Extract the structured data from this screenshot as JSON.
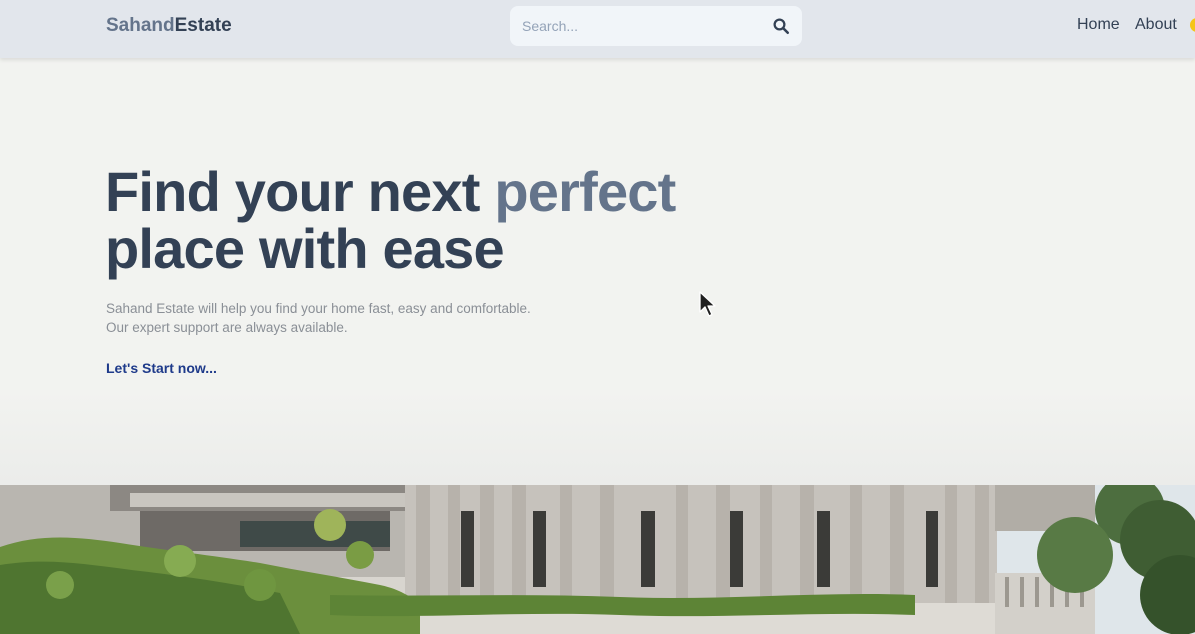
{
  "header": {
    "logo_part1": "Sahand",
    "logo_part2": "Estate",
    "search_placeholder": "Search...",
    "nav": [
      "Home",
      "About"
    ]
  },
  "hero": {
    "title_line1": "Find your next ",
    "title_accent": "perfect",
    "title_line2": "place with ease",
    "desc_line1": "Sahand Estate will help you find your home fast, easy and comfortable.",
    "desc_line2": "Our expert support are always available.",
    "cta": "Let's Start now..."
  },
  "icons": {
    "search": "search-icon",
    "cursor": "mouse-pointer-icon"
  },
  "colors": {
    "header_bg": "#e2e6ec",
    "logo_light": "#64748b",
    "logo_dark": "#334155",
    "title": "#334155",
    "accent": "#64748b",
    "cta": "#1e3a8a",
    "page_bg": "#f1f2ef"
  }
}
